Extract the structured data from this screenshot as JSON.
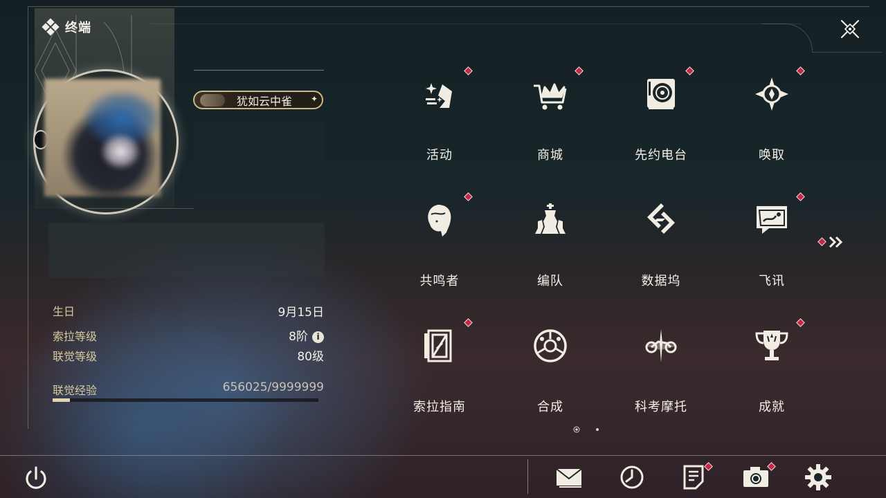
{
  "window": {
    "title": "终端",
    "close_label": "close"
  },
  "profile": {
    "name": "犹如云中雀",
    "birthday_label": "生日",
    "birthday_value": "9月15日",
    "sola_level_label": "索拉等级",
    "sola_level_value": "8阶",
    "union_level_label": "联觉等级",
    "union_level_value": "80级",
    "union_exp_label": "联觉经验",
    "union_exp_value": "656025/9999999",
    "union_exp_fraction": 0.066
  },
  "menu": {
    "items": [
      {
        "label": "活动",
        "icon": "activity-icon",
        "badge": true
      },
      {
        "label": "商城",
        "icon": "shop-crown-cart-icon",
        "badge": true
      },
      {
        "label": "先约电台",
        "icon": "radio-record-icon",
        "badge": true
      },
      {
        "label": "唤取",
        "icon": "convene-compass-icon",
        "badge": true
      },
      {
        "label": "共鸣者",
        "icon": "resonator-portrait-icon",
        "badge": true
      },
      {
        "label": "编队",
        "icon": "team-chess-icon",
        "badge": false
      },
      {
        "label": "数据坞",
        "icon": "data-bank-icon",
        "badge": false
      },
      {
        "label": "飞讯",
        "icon": "message-bubble-icon",
        "badge": true
      },
      {
        "label": "索拉指南",
        "icon": "guidebook-icon",
        "badge": true
      },
      {
        "label": "合成",
        "icon": "synthesis-icon",
        "badge": false
      },
      {
        "label": "科考摩托",
        "icon": "motorcycle-icon",
        "badge": false
      },
      {
        "label": "成就",
        "icon": "trophy-icon",
        "badge": true
      }
    ],
    "page_count": 2,
    "current_page": 1,
    "next_badge": true
  },
  "bottom_bar": {
    "power": "power-icon",
    "mail": "mail-icon",
    "clock": "clock-icon",
    "notes": "notes-icon",
    "camera": "camera-icon",
    "settings": "settings-gear-icon"
  },
  "colors": {
    "badge_red": "#c42a45",
    "label_gold": "#d8c8a0",
    "text_light": "#f3f0e8"
  }
}
